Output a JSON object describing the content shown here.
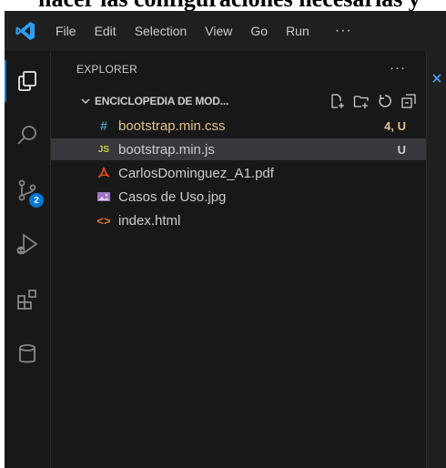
{
  "caption": "hacer las configuraciones necesarias y",
  "menu": [
    "File",
    "Edit",
    "Selection",
    "View",
    "Go",
    "Run"
  ],
  "menu_more": "···",
  "activity": {
    "scm_badge": "2"
  },
  "explorer": {
    "title": "EXPLORER",
    "more": "···",
    "folder": "ENCICLOPEDIA DE MOD...",
    "files": [
      {
        "icon": "#",
        "name": "bootstrap.min.css",
        "status": "4, U",
        "color": "#e2c08d",
        "icon_color": "#519aba"
      },
      {
        "icon": "JS",
        "name": "bootstrap.min.js",
        "status": "U",
        "color": "#cccccc",
        "icon_color": "#cbcb41"
      },
      {
        "icon": "pdf",
        "name": "CarlosDominguez_A1.pdf",
        "status": "",
        "color": "#cccccc",
        "icon_color": "#e44d26"
      },
      {
        "icon": "image",
        "name": "Casos de Uso.jpg",
        "status": "",
        "color": "#cccccc",
        "icon_color": "#a074c4"
      },
      {
        "icon": "<>",
        "name": "index.html",
        "status": "",
        "color": "#cccccc",
        "icon_color": "#e37933"
      }
    ]
  },
  "colors": {
    "background": "#1f1f1f",
    "accent": "#0078d4",
    "modified": "#e2c08d",
    "selected_row": "#37373d"
  }
}
